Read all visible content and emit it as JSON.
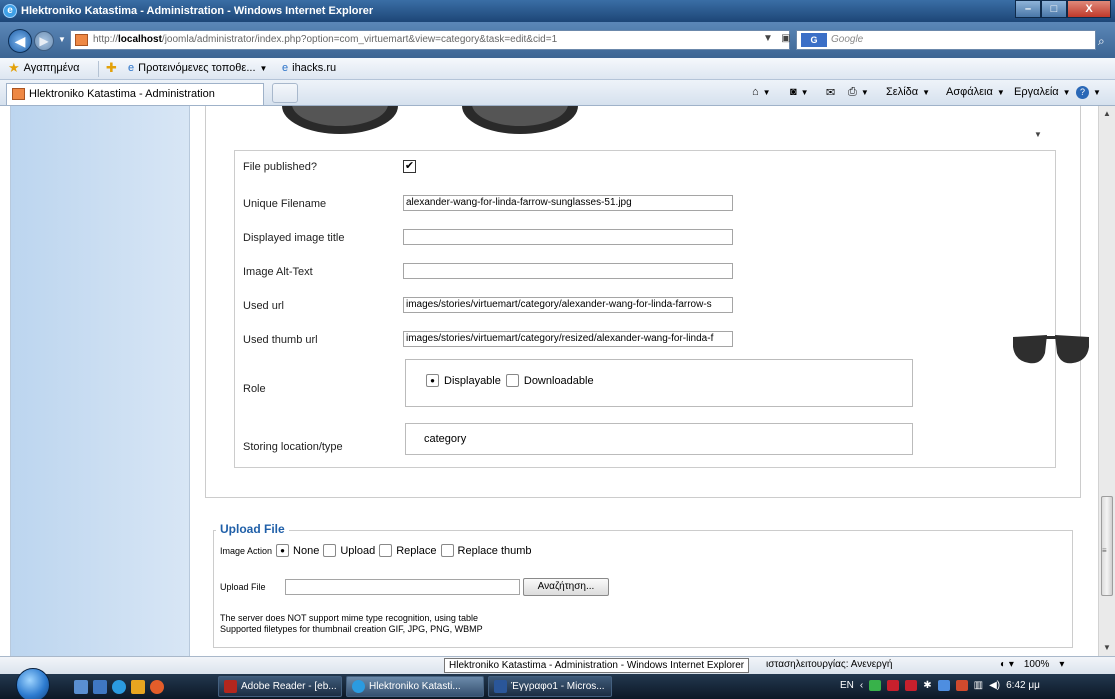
{
  "window": {
    "title": "Hlektroniko Katastima - Administration - Windows Internet Explorer",
    "minimize_label": "–",
    "maximize_label": "□",
    "close_label": "X"
  },
  "address_bar": {
    "url_prefix": "http://",
    "url_host": "localhost",
    "url_rest": "/joomla/administrator/index.php?option=com_virtuemart&view=category&task=edit&cid=1",
    "search_placeholder": "Google",
    "search_engine_label": "G"
  },
  "favorites_bar": {
    "favorites_label": "Αγαπημένα",
    "suggested_label": "Προτεινόμενες τοποθε...",
    "link_label": "ihacks.ru"
  },
  "tab_bar": {
    "tab_label": "Hlektroniko Katastima - Administration",
    "commands": [
      "Σελίδα",
      "Ασφάλεια",
      "Εργαλεία"
    ]
  },
  "form": {
    "file_published_label": "File published?",
    "file_published_checked": true,
    "unique_filename_label": "Unique Filename",
    "unique_filename_value": "alexander-wang-for-linda-farrow-sunglasses-51.jpg",
    "image_title_label": "Displayed image title",
    "image_title_value": "",
    "alt_text_label": "Image Alt-Text",
    "alt_text_value": "",
    "used_url_label": "Used url",
    "used_url_value": "images/stories/virtuemart/category/alexander-wang-for-linda-farrow-s",
    "used_thumb_url_label": "Used thumb url",
    "used_thumb_url_value": "images/stories/virtuemart/category/resized/alexander-wang-for-linda-f",
    "role_label": "Role",
    "role_options": [
      "Displayable",
      "Downloadable"
    ],
    "role_selected": "Displayable",
    "storing_label": "Storing location/type",
    "storing_value": "category"
  },
  "upload": {
    "legend": "Upload File",
    "image_action_label": "Image Action",
    "actions": [
      "None",
      "Upload",
      "Replace",
      "Replace thumb"
    ],
    "selected_action": "None",
    "upload_file_label": "Upload File",
    "browse_button": "Αναζήτηση...",
    "note_1": "The server does NOT support mime type recognition, using table",
    "note_2": "Supported filetypes for thumbnail creation GIF, JPG, PNG, WBMP"
  },
  "status_bar": {
    "tooltip": "Hlektroniko Katastima - Administration - Windows Internet Explorer",
    "mode_text": "ιστασηλειτουργίας: Ανενεργή",
    "zoom": "100%"
  },
  "taskbar": {
    "tasks": [
      "Adobe Reader - [eb...",
      "Hlektroniko Katasti...",
      "Έγγραφο1 - Micros..."
    ],
    "lang": "EN",
    "clock": "6:42 μμ"
  },
  "colors": {
    "accent": "#1f5fa8",
    "titlebar": "#1d4677",
    "sidebar": "#bcd5ef"
  }
}
